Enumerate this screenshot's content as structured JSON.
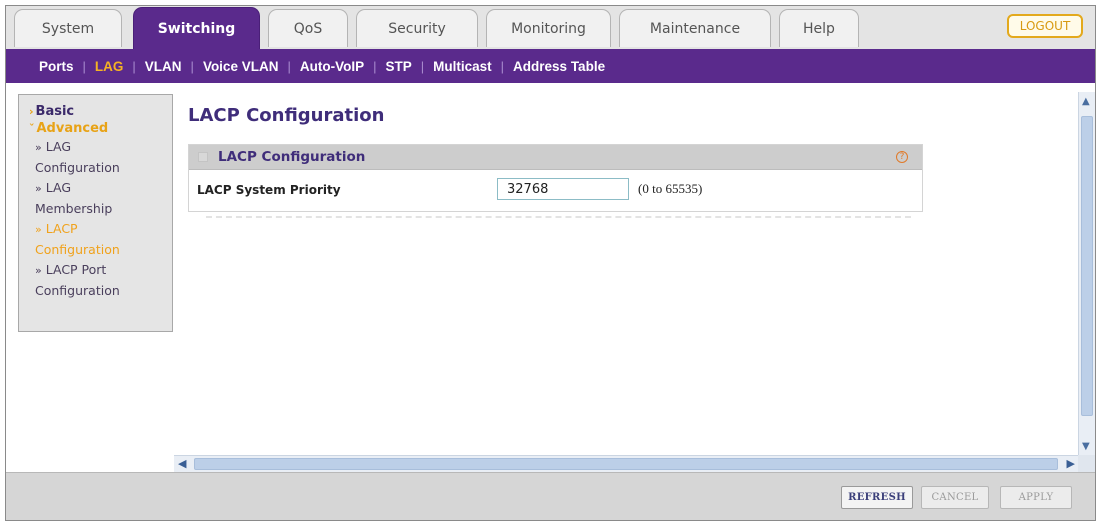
{
  "tabs": [
    {
      "label": "System",
      "active": false
    },
    {
      "label": "Switching",
      "active": true
    },
    {
      "label": "QoS",
      "active": false
    },
    {
      "label": "Security",
      "active": false
    },
    {
      "label": "Monitoring",
      "active": false
    },
    {
      "label": "Maintenance",
      "active": false
    },
    {
      "label": "Help",
      "active": false
    }
  ],
  "logout_label": "LOGOUT",
  "subnav": [
    {
      "label": "Ports",
      "active": false
    },
    {
      "label": "LAG",
      "active": true
    },
    {
      "label": "VLAN",
      "active": false
    },
    {
      "label": "Voice VLAN",
      "active": false
    },
    {
      "label": "Auto-VoIP",
      "active": false
    },
    {
      "label": "STP",
      "active": false
    },
    {
      "label": "Multicast",
      "active": false
    },
    {
      "label": "Address Table",
      "active": false
    }
  ],
  "leftmenu": {
    "basic": "Basic",
    "advanced": "Advanced",
    "items": [
      {
        "line1": "LAG",
        "line2": "Configuration",
        "active": false
      },
      {
        "line1": "LAG",
        "line2": "Membership",
        "active": false
      },
      {
        "line1": "LACP",
        "line2": "Configuration",
        "active": true
      },
      {
        "line1": "LACP Port",
        "line2": "Configuration",
        "active": false
      }
    ]
  },
  "page_title": "LACP Configuration",
  "panel": {
    "title": "LACP Configuration",
    "help_glyph": "?",
    "field_label": "LACP System Priority",
    "field_value": "32768",
    "field_range": "(0 to 65535)"
  },
  "buttons": {
    "refresh": "REFRESH",
    "cancel": "CANCEL",
    "apply": "APPLY"
  },
  "colors": {
    "brand_purple": "#5a2a8c",
    "accent_orange": "#f5b323"
  }
}
